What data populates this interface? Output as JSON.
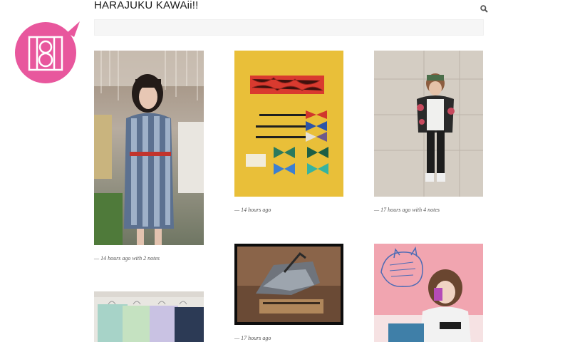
{
  "site": {
    "title": "HARAJUKU KAWAii!!"
  },
  "colors": {
    "logo_pink": "#e8579d",
    "search_bar": "#f6f6f6"
  },
  "icons": {
    "logo": "speech-bubble-logo-icon",
    "search": "magnifier-icon"
  },
  "posts": [
    {
      "id": "post-1",
      "meta": "— 14 hours ago with 2 notes"
    },
    {
      "id": "post-2",
      "meta": "— 14 hours ago"
    },
    {
      "id": "post-3",
      "meta": "— 17 hours ago with 4 notes"
    },
    {
      "id": "post-5",
      "meta": "— 17 hours ago"
    }
  ]
}
